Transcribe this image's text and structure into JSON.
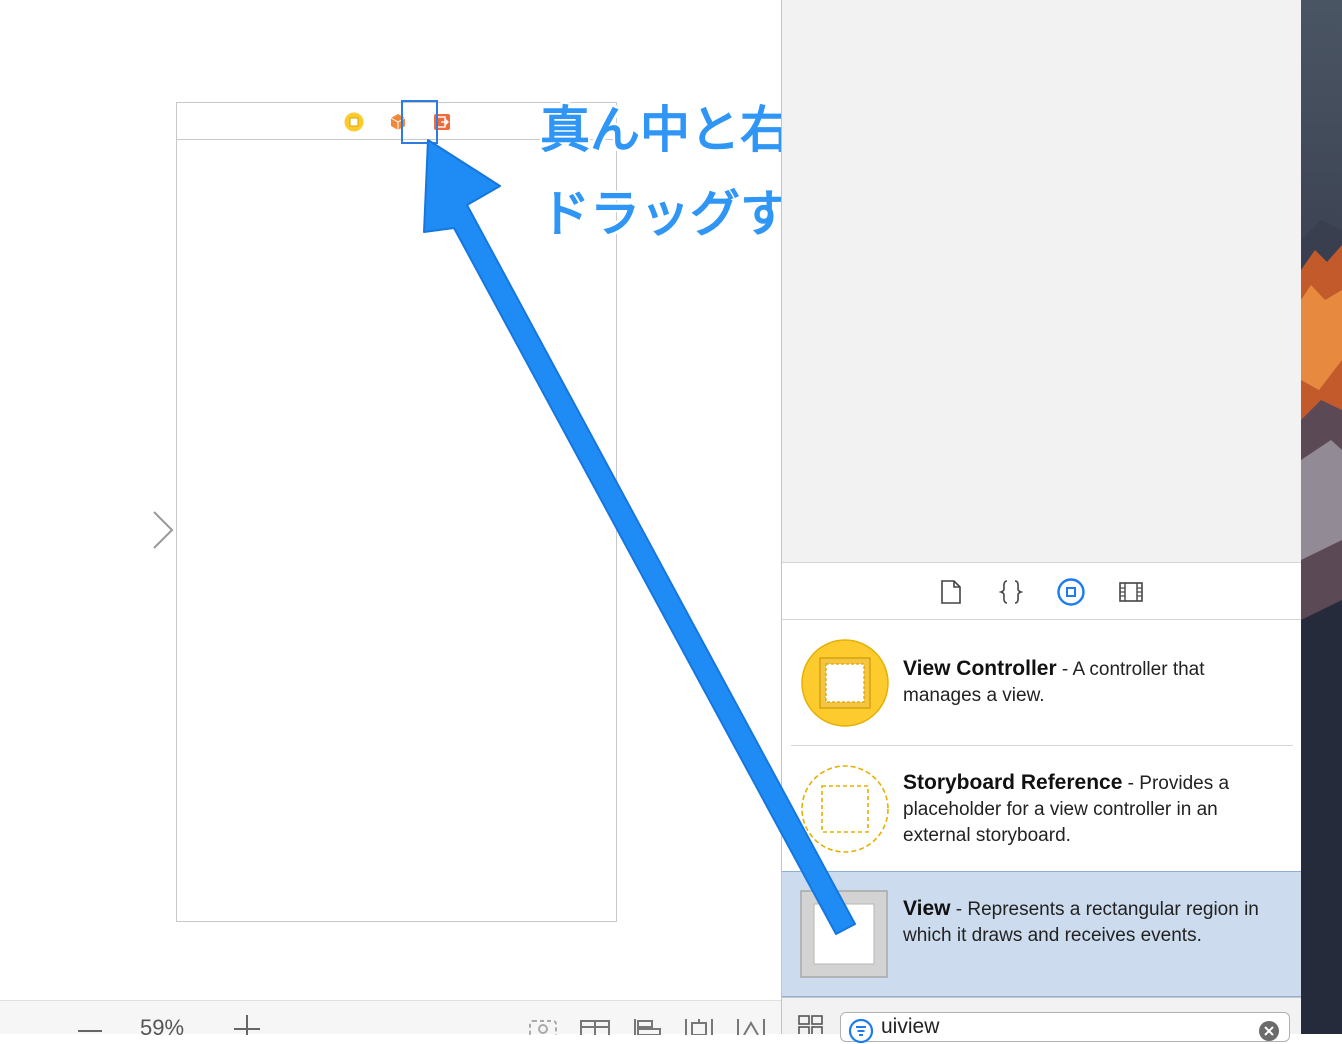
{
  "annotation": {
    "line1": "真ん中と右のアイコンの間に",
    "line2": "ドラッグすると、、、"
  },
  "canvas_bar": {
    "zoom_level": "59%"
  },
  "library": {
    "items": [
      {
        "title": "View Controller",
        "description": " - A controller that manages a view."
      },
      {
        "title": "Storyboard Reference",
        "description": " - Provides a placeholder for a view controller in an external storyboard."
      },
      {
        "title": "View",
        "description": " - Represents a rectangular region in which it draws and receives events."
      }
    ],
    "filter": {
      "value": "uiview"
    }
  },
  "colors": {
    "accent": "#2f96f5",
    "selection": "#ccdcee",
    "vc_yellow": "#fecb2f",
    "cube_orange": "#f0883a",
    "exit_orange": "#f06a3a"
  }
}
